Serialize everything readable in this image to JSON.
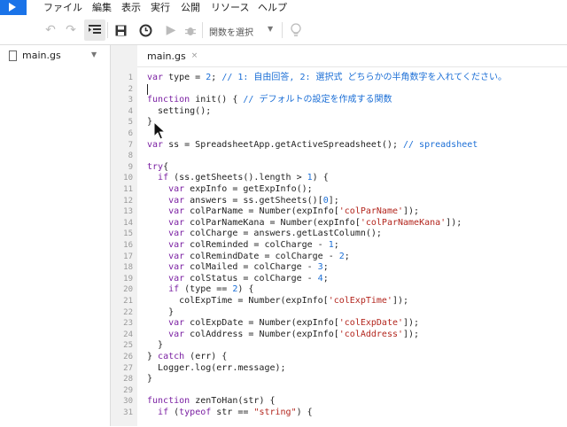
{
  "menubar": {
    "items": [
      "ファイル",
      "編集",
      "表示",
      "実行",
      "公開",
      "リソース",
      "ヘルプ"
    ]
  },
  "toolbar": {
    "function_select": "関数を選択"
  },
  "sidebar": {
    "file_name": "main.gs"
  },
  "editor": {
    "tab_label": "main.gs",
    "tab_close": "×",
    "lines": [
      {
        "n": "1",
        "t": [
          [
            "kw",
            "var"
          ],
          [
            "plain",
            " type = "
          ],
          [
            "num",
            "2"
          ],
          [
            "plain",
            "; "
          ],
          [
            "cmt",
            "// 1: 自由回答, 2: 選択式 どちらかの半角数字を入れてください。"
          ]
        ]
      },
      {
        "n": "2",
        "t": []
      },
      {
        "n": "3",
        "t": [
          [
            "kw",
            "function"
          ],
          [
            "plain",
            " init() { "
          ],
          [
            "cmt",
            "// デフォルトの設定を作成する関数"
          ]
        ]
      },
      {
        "n": "4",
        "t": [
          [
            "plain",
            "  setting();"
          ]
        ]
      },
      {
        "n": "5",
        "t": [
          [
            "plain",
            "}"
          ]
        ]
      },
      {
        "n": "6",
        "t": []
      },
      {
        "n": "7",
        "t": [
          [
            "kw",
            "var"
          ],
          [
            "plain",
            " ss = SpreadsheetApp.getActiveSpreadsheet(); "
          ],
          [
            "cmt",
            "// spreadsheet"
          ]
        ]
      },
      {
        "n": "8",
        "t": []
      },
      {
        "n": "9",
        "t": [
          [
            "kw",
            "try"
          ],
          [
            "plain",
            "{"
          ]
        ]
      },
      {
        "n": "10",
        "t": [
          [
            "plain",
            "  "
          ],
          [
            "kw",
            "if"
          ],
          [
            "plain",
            " (ss.getSheets().length > "
          ],
          [
            "num",
            "1"
          ],
          [
            "plain",
            ") {"
          ]
        ]
      },
      {
        "n": "11",
        "t": [
          [
            "plain",
            "    "
          ],
          [
            "kw",
            "var"
          ],
          [
            "plain",
            " expInfo = getExpInfo();"
          ]
        ]
      },
      {
        "n": "12",
        "t": [
          [
            "plain",
            "    "
          ],
          [
            "kw",
            "var"
          ],
          [
            "plain",
            " answers = ss.getSheets()["
          ],
          [
            "num",
            "0"
          ],
          [
            "plain",
            "];"
          ]
        ]
      },
      {
        "n": "13",
        "t": [
          [
            "plain",
            "    "
          ],
          [
            "kw",
            "var"
          ],
          [
            "plain",
            " colParName = Number(expInfo["
          ],
          [
            "str",
            "'colParName'"
          ],
          [
            "plain",
            "]);"
          ]
        ]
      },
      {
        "n": "14",
        "t": [
          [
            "plain",
            "    "
          ],
          [
            "kw",
            "var"
          ],
          [
            "plain",
            " colParNameKana = Number(expInfo["
          ],
          [
            "str",
            "'colParNameKana'"
          ],
          [
            "plain",
            "]);"
          ]
        ]
      },
      {
        "n": "15",
        "t": [
          [
            "plain",
            "    "
          ],
          [
            "kw",
            "var"
          ],
          [
            "plain",
            " colCharge = answers.getLastColumn();"
          ]
        ]
      },
      {
        "n": "16",
        "t": [
          [
            "plain",
            "    "
          ],
          [
            "kw",
            "var"
          ],
          [
            "plain",
            " colReminded = colCharge - "
          ],
          [
            "num",
            "1"
          ],
          [
            "plain",
            ";"
          ]
        ]
      },
      {
        "n": "17",
        "t": [
          [
            "plain",
            "    "
          ],
          [
            "kw",
            "var"
          ],
          [
            "plain",
            " colRemindDate = colCharge - "
          ],
          [
            "num",
            "2"
          ],
          [
            "plain",
            ";"
          ]
        ]
      },
      {
        "n": "18",
        "t": [
          [
            "plain",
            "    "
          ],
          [
            "kw",
            "var"
          ],
          [
            "plain",
            " colMailed = colCharge - "
          ],
          [
            "num",
            "3"
          ],
          [
            "plain",
            ";"
          ]
        ]
      },
      {
        "n": "19",
        "t": [
          [
            "plain",
            "    "
          ],
          [
            "kw",
            "var"
          ],
          [
            "plain",
            " colStatus = colCharge - "
          ],
          [
            "num",
            "4"
          ],
          [
            "plain",
            ";"
          ]
        ]
      },
      {
        "n": "20",
        "t": [
          [
            "plain",
            "    "
          ],
          [
            "kw",
            "if"
          ],
          [
            "plain",
            " (type == "
          ],
          [
            "num",
            "2"
          ],
          [
            "plain",
            ") {"
          ]
        ]
      },
      {
        "n": "21",
        "t": [
          [
            "plain",
            "      colExpTime = Number(expInfo["
          ],
          [
            "str",
            "'colExpTime'"
          ],
          [
            "plain",
            "]);"
          ]
        ]
      },
      {
        "n": "22",
        "t": [
          [
            "plain",
            "    }"
          ]
        ]
      },
      {
        "n": "23",
        "t": [
          [
            "plain",
            "    "
          ],
          [
            "kw",
            "var"
          ],
          [
            "plain",
            " colExpDate = Number(expInfo["
          ],
          [
            "str",
            "'colExpDate'"
          ],
          [
            "plain",
            "]);"
          ]
        ]
      },
      {
        "n": "24",
        "t": [
          [
            "plain",
            "    "
          ],
          [
            "kw",
            "var"
          ],
          [
            "plain",
            " colAddress = Number(expInfo["
          ],
          [
            "str",
            "'colAddress'"
          ],
          [
            "plain",
            "]);"
          ]
        ]
      },
      {
        "n": "25",
        "t": [
          [
            "plain",
            "  }"
          ]
        ]
      },
      {
        "n": "26",
        "t": [
          [
            "plain",
            "} "
          ],
          [
            "kw",
            "catch"
          ],
          [
            "plain",
            " (err) {"
          ]
        ]
      },
      {
        "n": "27",
        "t": [
          [
            "plain",
            "  Logger.log(err.message);"
          ]
        ]
      },
      {
        "n": "28",
        "t": [
          [
            "plain",
            "}"
          ]
        ]
      },
      {
        "n": "29",
        "t": []
      },
      {
        "n": "30",
        "t": [
          [
            "kw",
            "function"
          ],
          [
            "plain",
            " zenToHan(str) {"
          ]
        ]
      },
      {
        "n": "31",
        "t": [
          [
            "plain",
            "  "
          ],
          [
            "kw",
            "if"
          ],
          [
            "plain",
            " ("
          ],
          [
            "kw",
            "typeof"
          ],
          [
            "plain",
            " str == "
          ],
          [
            "str",
            "\"string\""
          ],
          [
            "plain",
            ") {"
          ]
        ]
      }
    ]
  }
}
